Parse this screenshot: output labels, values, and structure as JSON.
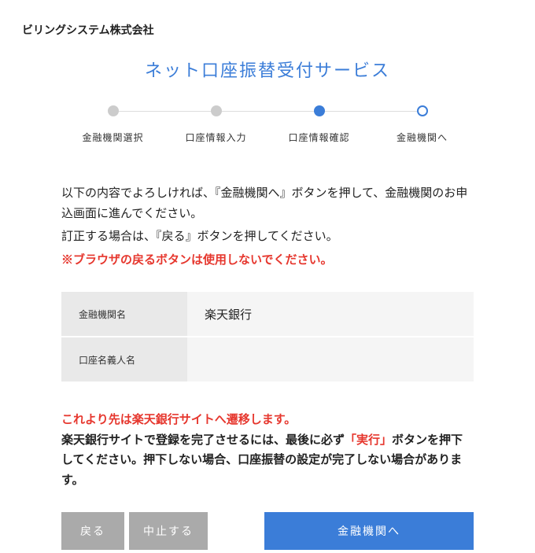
{
  "company": "ビリングシステム株式会社",
  "serviceTitle": "ネット口座振替受付サービス",
  "steps": [
    {
      "label": "金融機関選択",
      "state": "done"
    },
    {
      "label": "口座情報入力",
      "state": "done"
    },
    {
      "label": "口座情報確認",
      "state": "active"
    },
    {
      "label": "金融機関へ",
      "state": "pending"
    }
  ],
  "instruction1": "以下の内容でよろしければ、『金融機関へ』ボタンを押して、金融機関のお申込画面に進んでください。",
  "instruction2": "訂正する場合は、『戻る』ボタンを押してください。",
  "warning": "※ブラウザの戻るボタンは使用しないでください。",
  "fields": {
    "bankLabel": "金融機関名",
    "bankValue": "楽天銀行",
    "holderLabel": "口座名義人名",
    "holderValue": ""
  },
  "noticeRed": "これより先は楽天銀行サイトへ遷移します。",
  "noticeBlack1": "楽天銀行サイトで登録を完了させるには、最後に必ず",
  "noticeEm": "「実行」",
  "noticeBlack2": "ボタンを押下してください。押下しない場合、口座振替の設定が完了しない場合があります。",
  "buttons": {
    "back": "戻る",
    "cancel": "中止する",
    "proceed": "金融機関へ"
  }
}
